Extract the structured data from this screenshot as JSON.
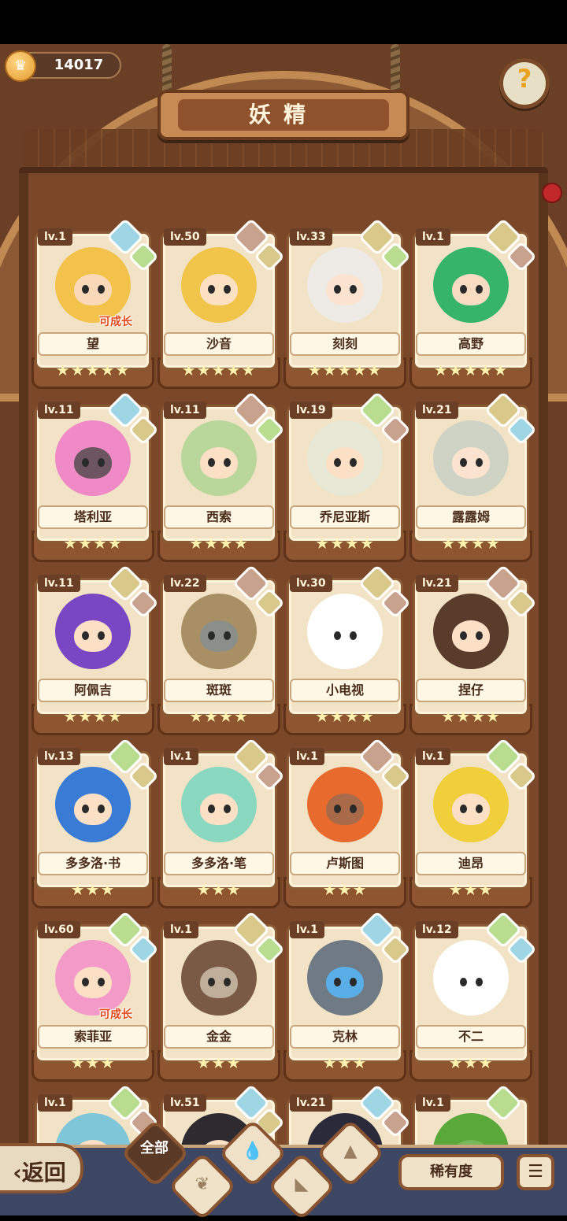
{
  "header": {
    "coins": "14017",
    "title": "妖精",
    "help_icon": "question-bulb-icon"
  },
  "colors": {
    "background": "#6b3f25",
    "card": "#f3e3c6",
    "bottom_bar": "#3d4663",
    "grow_tag": "#e24a1e"
  },
  "cards": [
    {
      "level": "lv.1",
      "name": "望",
      "stars": "★★★★★",
      "main": "water",
      "sub": "grass",
      "hair": "#f2c24a",
      "skin": "#f9d9b8",
      "tag": "可成长"
    },
    {
      "level": "lv.50",
      "name": "沙音",
      "stars": "★★★★★",
      "main": "fire",
      "sub": "rock",
      "hair": "#f0c54a",
      "skin": "#fbe0c2",
      "tag": ""
    },
    {
      "level": "lv.33",
      "name": "刻刻",
      "stars": "★★★★★",
      "main": "rock",
      "sub": "grass",
      "hair": "#eeeae6",
      "skin": "#fbe3cf",
      "tag": ""
    },
    {
      "level": "lv.1",
      "name": "高野",
      "stars": "★★★★★",
      "main": "rock",
      "sub": "fire",
      "hair": "#36b56a",
      "skin": "#f7dcc2",
      "tag": ""
    },
    {
      "level": "lv.11",
      "name": "塔利亚",
      "stars": "★★★★",
      "main": "water",
      "sub": "rock",
      "hair": "#f08ac6",
      "skin": "#6c5560",
      "tag": ""
    },
    {
      "level": "lv.11",
      "name": "西索",
      "stars": "★★★★",
      "main": "fire",
      "sub": "grass",
      "hair": "#b9d79a",
      "skin": "#fbe0c6",
      "tag": ""
    },
    {
      "level": "lv.19",
      "name": "乔尼亚斯",
      "stars": "★★★★",
      "main": "grass",
      "sub": "fire",
      "hair": "#e7e8d6",
      "skin": "#fbe0c6",
      "tag": ""
    },
    {
      "level": "lv.21",
      "name": "露露姆",
      "stars": "★★★★",
      "main": "rock",
      "sub": "water",
      "hair": "#cfd3c6",
      "skin": "#fbe3cf",
      "tag": ""
    },
    {
      "level": "lv.11",
      "name": "阿佩吉",
      "stars": "★★★★",
      "main": "rock",
      "sub": "fire",
      "hair": "#7a47c4",
      "skin": "#fbe0c6",
      "tag": ""
    },
    {
      "level": "lv.22",
      "name": "斑斑",
      "stars": "★★★★",
      "main": "fire",
      "sub": "rock",
      "hair": "#a89064",
      "skin": "#8a8f8a",
      "tag": ""
    },
    {
      "level": "lv.30",
      "name": "小电视",
      "stars": "★★★★",
      "main": "rock",
      "sub": "fire",
      "hair": "#ffffff",
      "skin": "#ffffff",
      "tag": ""
    },
    {
      "level": "lv.21",
      "name": "捏仔",
      "stars": "★★★★",
      "main": "fire",
      "sub": "rock",
      "hair": "#5a3c2c",
      "skin": "#fbe0c6",
      "tag": ""
    },
    {
      "level": "lv.13",
      "name": "多多洛·书",
      "stars": "★★★",
      "main": "grass",
      "sub": "rock",
      "hair": "#3a7bd5",
      "skin": "#fbe0c6",
      "tag": ""
    },
    {
      "level": "lv.1",
      "name": "多多洛·笔",
      "stars": "★★★",
      "main": "rock",
      "sub": "fire",
      "hair": "#8ad8c0",
      "skin": "#fbe0c6",
      "tag": ""
    },
    {
      "level": "lv.1",
      "name": "卢斯图",
      "stars": "★★★",
      "main": "fire",
      "sub": "rock",
      "hair": "#e86a2c",
      "skin": "#a86a48",
      "tag": ""
    },
    {
      "level": "lv.1",
      "name": "迪昂",
      "stars": "★★★",
      "main": "grass",
      "sub": "rock",
      "hair": "#f0cf3a",
      "skin": "#fbe0c6",
      "tag": ""
    },
    {
      "level": "lv.60",
      "name": "索菲亚",
      "stars": "★★★",
      "main": "grass",
      "sub": "water",
      "hair": "#f49ac8",
      "skin": "#fbe0c6",
      "tag": "可成长"
    },
    {
      "level": "lv.1",
      "name": "金金",
      "stars": "★★★",
      "main": "rock",
      "sub": "grass",
      "hair": "#7a5a44",
      "skin": "#bfae9a",
      "tag": ""
    },
    {
      "level": "lv.1",
      "name": "克林",
      "stars": "★★★",
      "main": "water",
      "sub": "rock",
      "hair": "#6f7a84",
      "skin": "#5aaee8",
      "tag": ""
    },
    {
      "level": "lv.12",
      "name": "不二",
      "stars": "★★★",
      "main": "grass",
      "sub": "water",
      "hair": "#ffffff",
      "skin": "#ffffff",
      "tag": ""
    },
    {
      "level": "lv.1",
      "name": "",
      "stars": "",
      "main": "grass",
      "sub": "fire",
      "hair": "#7fc7d8",
      "skin": "#fbe0c6",
      "tag": ""
    },
    {
      "level": "lv.51",
      "name": "",
      "stars": "",
      "main": "water",
      "sub": "rock",
      "hair": "#2d2a30",
      "skin": "#fbe0c6",
      "tag": ""
    },
    {
      "level": "lv.21",
      "name": "",
      "stars": "",
      "main": "water",
      "sub": "fire",
      "hair": "#2b2a3a",
      "skin": "#fbe0c6",
      "tag": ""
    },
    {
      "level": "lv.1",
      "name": "",
      "stars": "",
      "main": "grass",
      "sub": "",
      "hair": "#5aa83a",
      "skin": "#78b85a",
      "tag": ""
    }
  ],
  "bottom": {
    "back_label": "‹返回",
    "filters": [
      "全部",
      "water",
      "grass",
      "fire",
      "rock"
    ],
    "rarity_label": "稀有度",
    "sort_icon": "sort-list-icon"
  }
}
